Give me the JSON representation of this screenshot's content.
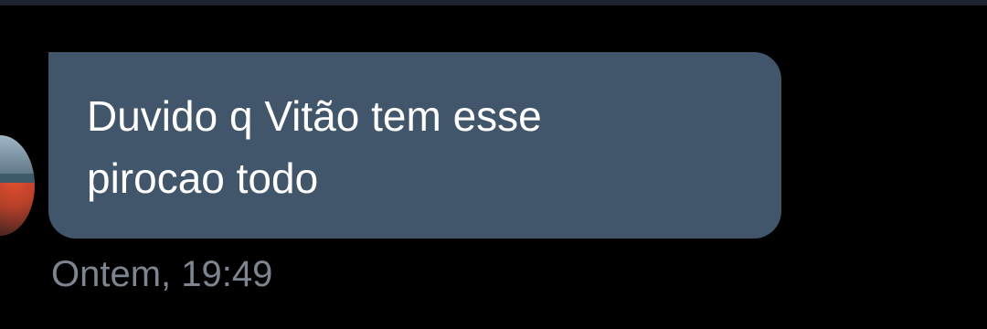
{
  "message": {
    "text": "Duvido q Vitão tem esse\npirocao todo",
    "timestamp": "Ontem, 19:49",
    "sender_avatar_icon": "avatar-photo"
  },
  "colors": {
    "background": "#000000",
    "bubble": "#41566a",
    "message_text": "#ffffff",
    "timestamp_text": "#7d8590"
  }
}
